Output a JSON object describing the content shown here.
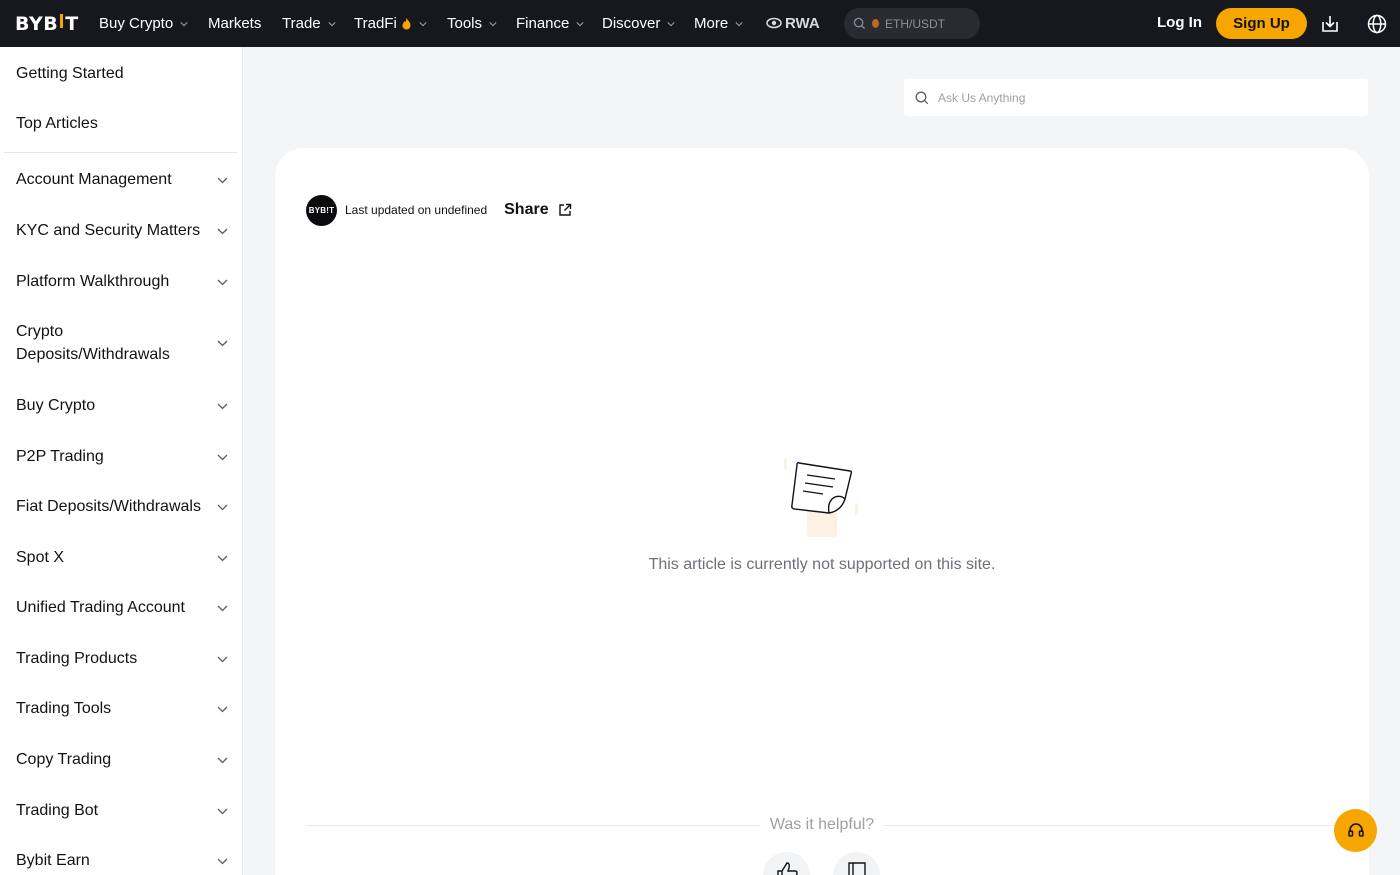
{
  "brand": {
    "logo_text_left": "BYB",
    "logo_text_right": "T"
  },
  "nav": {
    "items": [
      {
        "label": "Buy Crypto",
        "has_menu": true
      },
      {
        "label": "Markets",
        "has_menu": false
      },
      {
        "label": "Trade",
        "has_menu": true
      },
      {
        "label": "TradFi",
        "has_menu": true
      },
      {
        "label": "Tools",
        "has_menu": true
      },
      {
        "label": "Finance",
        "has_menu": true
      },
      {
        "label": "Discover",
        "has_menu": true
      },
      {
        "label": "More",
        "has_menu": true
      }
    ],
    "rwa_label": "RWA",
    "search_placeholder": "ETH/USDT",
    "login_label": "Log In",
    "signup_label": "Sign Up"
  },
  "sidebar": {
    "top_links": [
      "Getting Started",
      "Top Articles"
    ],
    "categories": [
      "Account Management",
      "KYC and Security Matters",
      "Platform Walkthrough",
      "Crypto Deposits/Withdrawals",
      "Buy Crypto",
      "P2P Trading",
      "Fiat Deposits/Withdrawals",
      "Spot X",
      "Unified Trading Account",
      "Trading Products",
      "Trading Tools",
      "Copy Trading",
      "Trading Bot",
      "Bybit Earn"
    ]
  },
  "main": {
    "ask_placeholder": "Ask Us Anything",
    "avatar_text": "BYB!T",
    "updated_text": "Last updated on undefined",
    "share_label": "Share",
    "empty_message": "This article is currently not supported on this site.",
    "helpful_prompt": "Was it helpful?"
  },
  "colors": {
    "accent": "#f7a600",
    "topbar": "#17181e",
    "page_bg": "#f4f5f7"
  },
  "icons": [
    "search-icon",
    "download-icon",
    "globe-icon",
    "chevron-down-icon",
    "external-link-icon",
    "thumbs-up-icon",
    "thumbs-down-icon",
    "headset-icon",
    "document-icon"
  ]
}
